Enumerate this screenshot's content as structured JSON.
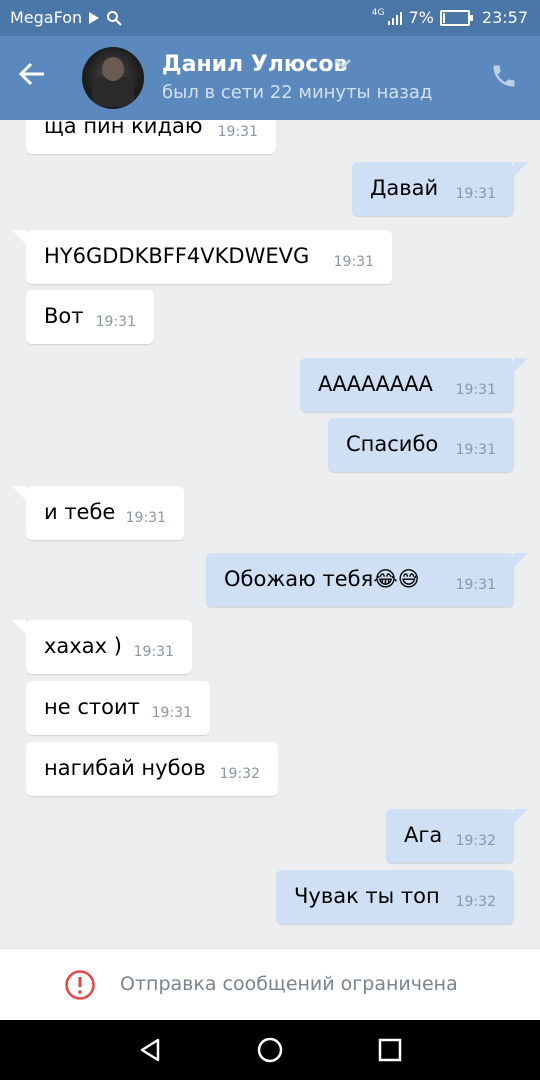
{
  "statusbar": {
    "carrier": "MegaFon",
    "network": "4G",
    "battery_percent": "7%",
    "battery_level": 0.07,
    "time": "23:57"
  },
  "header": {
    "contact_name": "Данил Улюсов",
    "contact_status": "был в сети 22 минуты назад",
    "back_icon": "arrow-left-icon",
    "call_icon": "phone-icon",
    "accent_color": "#5b88bd"
  },
  "messages": [
    {
      "dir": "in",
      "text": "ща пин кидаю",
      "time": "19:31"
    },
    {
      "dir": "out",
      "text": "Давай",
      "time": "19:31"
    },
    {
      "dir": "in",
      "text": "HY6GDDKBFF4VKDWEVG",
      "time": "19:31"
    },
    {
      "dir": "in",
      "text": "Вот",
      "time": "19:31"
    },
    {
      "dir": "out",
      "text": "АААААААА",
      "time": "19:31"
    },
    {
      "dir": "out",
      "text": "Спасибо",
      "time": "19:31"
    },
    {
      "dir": "in",
      "text": "и тебе",
      "time": "19:31"
    },
    {
      "dir": "out",
      "text": "Обожаю тебя😂😅",
      "time": "19:31"
    },
    {
      "dir": "in",
      "text": "хахах )",
      "time": "19:31"
    },
    {
      "dir": "in",
      "text": "не стоит",
      "time": "19:31"
    },
    {
      "dir": "in",
      "text": "нагибай нубов",
      "time": "19:32"
    },
    {
      "dir": "out",
      "text": "Ага",
      "time": "19:32"
    },
    {
      "dir": "out",
      "text": "Чувак ты топ",
      "time": "19:32"
    }
  ],
  "bottom": {
    "notice": "Отправка сообщений ограничена",
    "icon": "warning-circle-icon"
  },
  "navbar": {
    "back": "nav-back-icon",
    "home": "nav-home-icon",
    "recents": "nav-recents-icon"
  }
}
